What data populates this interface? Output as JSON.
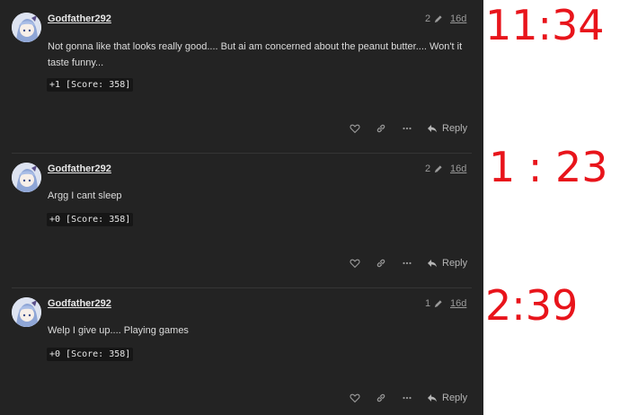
{
  "posts": [
    {
      "username": "Godfather292",
      "edit_count": "2",
      "date": "16d",
      "body_lines": [
        "Not gonna like that looks really good.... But ai am concerned about the peanut butter.... Won't it",
        "taste funny..."
      ],
      "code": "+1 [Score: 358]",
      "reply_label": "Reply",
      "annotation": "11:34"
    },
    {
      "username": "Godfather292",
      "edit_count": "2",
      "date": "16d",
      "body_lines": [
        "Argg I cant sleep"
      ],
      "code": "+0 [Score: 358]",
      "reply_label": "Reply",
      "annotation": "1 : 23"
    },
    {
      "username": "Godfather292",
      "edit_count": "1",
      "date": "16d",
      "body_lines": [
        "Welp I give up.... Playing games"
      ],
      "code": "+0 [Score: 358]",
      "reply_label": "Reply",
      "annotation": "2:39"
    }
  ],
  "colors": {
    "panel_bg": "#232323",
    "annotation": "#e8141b"
  },
  "icons": [
    "heart-icon",
    "link-icon",
    "more-icon",
    "reply-icon",
    "pencil-icon"
  ]
}
